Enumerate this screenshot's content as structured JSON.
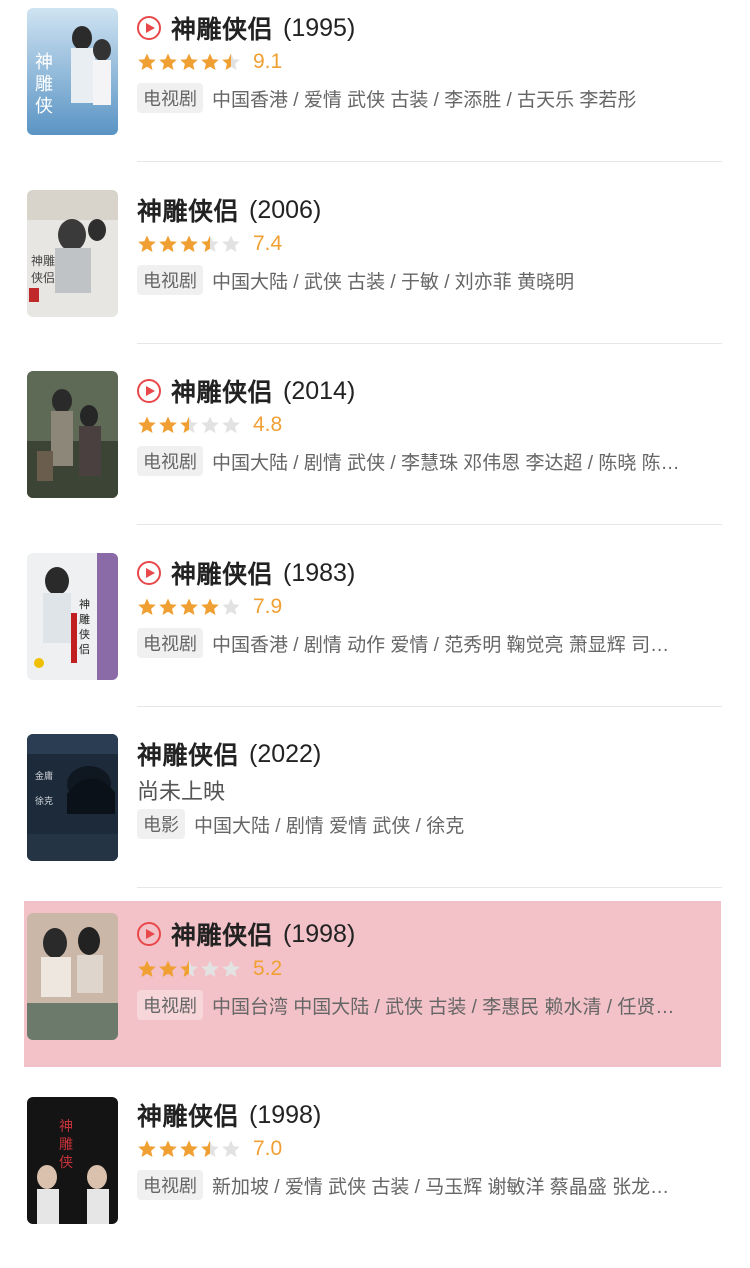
{
  "colors": {
    "accent_red": "#e8484a",
    "star_orange": "#f0a033",
    "highlight": "#f3c2c8"
  },
  "items": [
    {
      "title": "神雕侠侣",
      "year": "(1995)",
      "has_play": true,
      "rating": 4.5,
      "score": "9.1",
      "status": "",
      "tag": "电视剧",
      "info": "中国香港 / 爱情 武侠 古装 / 李添胜 / 古天乐 李若彤",
      "highlight": false,
      "poster_icon": "poster-1995"
    },
    {
      "title": "神雕侠侣",
      "year": "(2006)",
      "has_play": false,
      "rating": 3.5,
      "score": "7.4",
      "status": "",
      "tag": "电视剧",
      "info": "中国大陆 / 武侠 古装 / 于敏 / 刘亦菲 黄晓明",
      "highlight": false,
      "poster_icon": "poster-2006"
    },
    {
      "title": "神雕侠侣",
      "year": "(2014)",
      "has_play": true,
      "rating": 2.5,
      "score": "4.8",
      "status": "",
      "tag": "电视剧",
      "info": "中国大陆 / 剧情 武侠 / 李慧珠 邓伟恩 李达超 / 陈晓 陈…",
      "highlight": false,
      "poster_icon": "poster-2014"
    },
    {
      "title": "神雕侠侣",
      "year": "(1983)",
      "has_play": true,
      "rating": 4,
      "score": "7.9",
      "status": "",
      "tag": "电视剧",
      "info": "中国香港 / 剧情 动作 爱情 / 范秀明 鞠觉亮 萧显辉 司…",
      "highlight": false,
      "poster_icon": "poster-1983"
    },
    {
      "title": "神雕侠侣",
      "year": "(2022)",
      "has_play": false,
      "rating": null,
      "score": "",
      "status": "尚未上映",
      "tag": "电影",
      "info": "中国大陆 / 剧情 爱情 武侠 / 徐克",
      "highlight": false,
      "poster_icon": "poster-2022"
    },
    {
      "title": "神雕侠侣",
      "year": "(1998)",
      "has_play": true,
      "rating": 2.5,
      "score": "5.2",
      "status": "",
      "tag": "电视剧",
      "info": "中国台湾 中国大陆 / 武侠 古装 / 李惠民 赖水清 / 任贤…",
      "highlight": true,
      "poster_icon": "poster-1998-tw"
    },
    {
      "title": "神雕侠侣",
      "year": "(1998)",
      "has_play": false,
      "rating": 3.5,
      "score": "7.0",
      "status": "",
      "tag": "电视剧",
      "info": "新加坡 / 爱情 武侠 古装 / 马玉辉 谢敏洋 蔡晶盛 张龙…",
      "highlight": false,
      "poster_icon": "poster-1998-sg"
    }
  ]
}
